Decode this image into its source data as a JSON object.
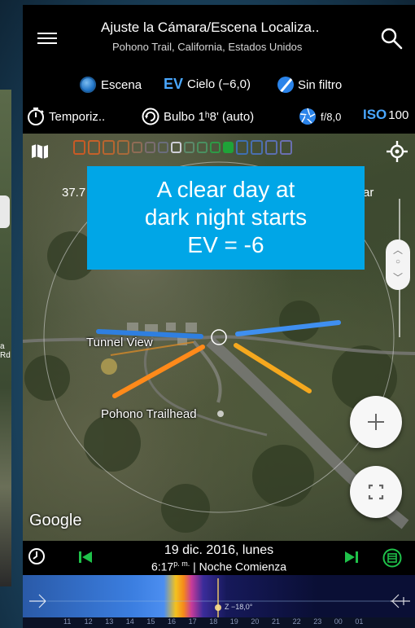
{
  "header": {
    "title": "Ajuste la Cámara/Escena Localiza..",
    "subtitle": "Pohono Trail, California, Estados Unidos"
  },
  "settings_row1": {
    "scene_label": "Escena",
    "ev_label": "EV",
    "sky_value": "Cielo (−6,0)",
    "filter_label": "Sin filtro"
  },
  "settings_row2": {
    "timer_label": "Temporiz..",
    "bulb_label": "Bulbo 1ʰ8' (auto)",
    "aperture_label": "f/8,0",
    "iso_label": "ISO",
    "iso_value": "100"
  },
  "map": {
    "coord_left": "37.7",
    "coord_right": "ar",
    "callout_text": [
      "A clear day at",
      "dark night starts",
      "EV = -6"
    ],
    "label_tunnel_view": "Tunnel View",
    "label_rd": "a Rd",
    "label_trailhead": "Pohono Trailhead",
    "google": "Google"
  },
  "datebar": {
    "date": "19 dic. 2016, lunes",
    "time": "6:17",
    "time_suffix": "p. m.",
    "event": "| Noche Comienza"
  },
  "timeline": {
    "hours": [
      "11",
      "12",
      "13",
      "14",
      "15",
      "16",
      "17",
      "18",
      "19",
      "20",
      "21",
      "22",
      "23",
      "00",
      "01"
    ],
    "marker_label": "Z −18,0°"
  },
  "colors": {
    "accent_blue": "#49a7ff",
    "callout_bg": "#00a6e7",
    "sun_line": "#ff8a1a",
    "moon_line": "#2f7fe0",
    "ev_box": "#c85a25"
  }
}
